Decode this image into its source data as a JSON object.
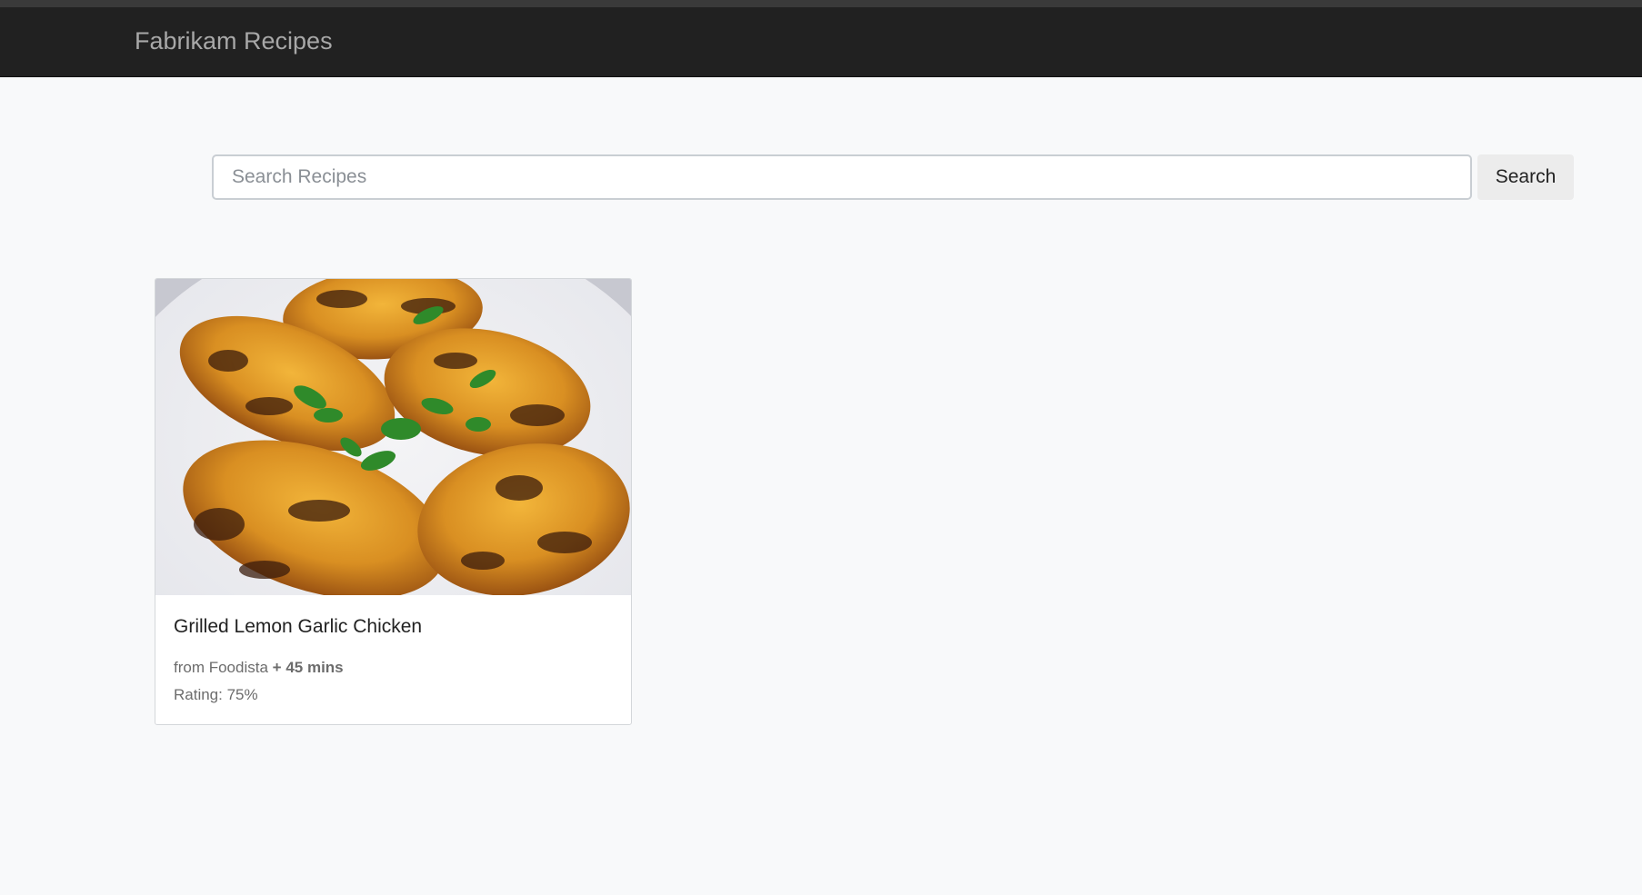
{
  "app": {
    "brand": "Fabrikam Recipes"
  },
  "search": {
    "placeholder": "Search Recipes",
    "value": "",
    "button_label": "Search"
  },
  "results": [
    {
      "title": "Grilled Lemon Garlic Chicken",
      "source_prefix": "from Foodista",
      "duration": "+ 45 mins",
      "rating_label": "Rating: 75%",
      "rating_percent": 75,
      "image": "grilled-chicken-photo"
    }
  ],
  "colors": {
    "navbar_bg": "#212121",
    "page_bg": "#f8f9fa",
    "brand_text": "#a8a8a8",
    "button_bg": "#ececec"
  }
}
